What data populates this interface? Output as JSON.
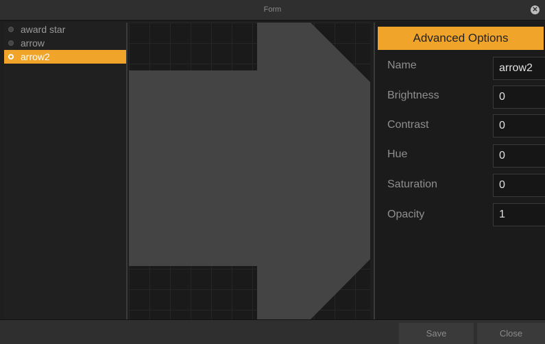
{
  "window": {
    "title": "Form"
  },
  "layers": [
    {
      "label": "award star",
      "selected": false
    },
    {
      "label": "arrow",
      "selected": false
    },
    {
      "label": "arrow2",
      "selected": true
    }
  ],
  "panel": {
    "header": "Advanced Options",
    "fields": [
      {
        "label": "Name",
        "value": "arrow2"
      },
      {
        "label": "Brightness",
        "value": "0"
      },
      {
        "label": "Contrast",
        "value": "0"
      },
      {
        "label": "Hue",
        "value": "0"
      },
      {
        "label": "Saturation",
        "value": "0"
      },
      {
        "label": "Opacity",
        "value": "1"
      }
    ]
  },
  "buttons": {
    "save": "Save",
    "close": "Close"
  },
  "colors": {
    "accent": "#f0a52a",
    "shape": "#444444"
  }
}
